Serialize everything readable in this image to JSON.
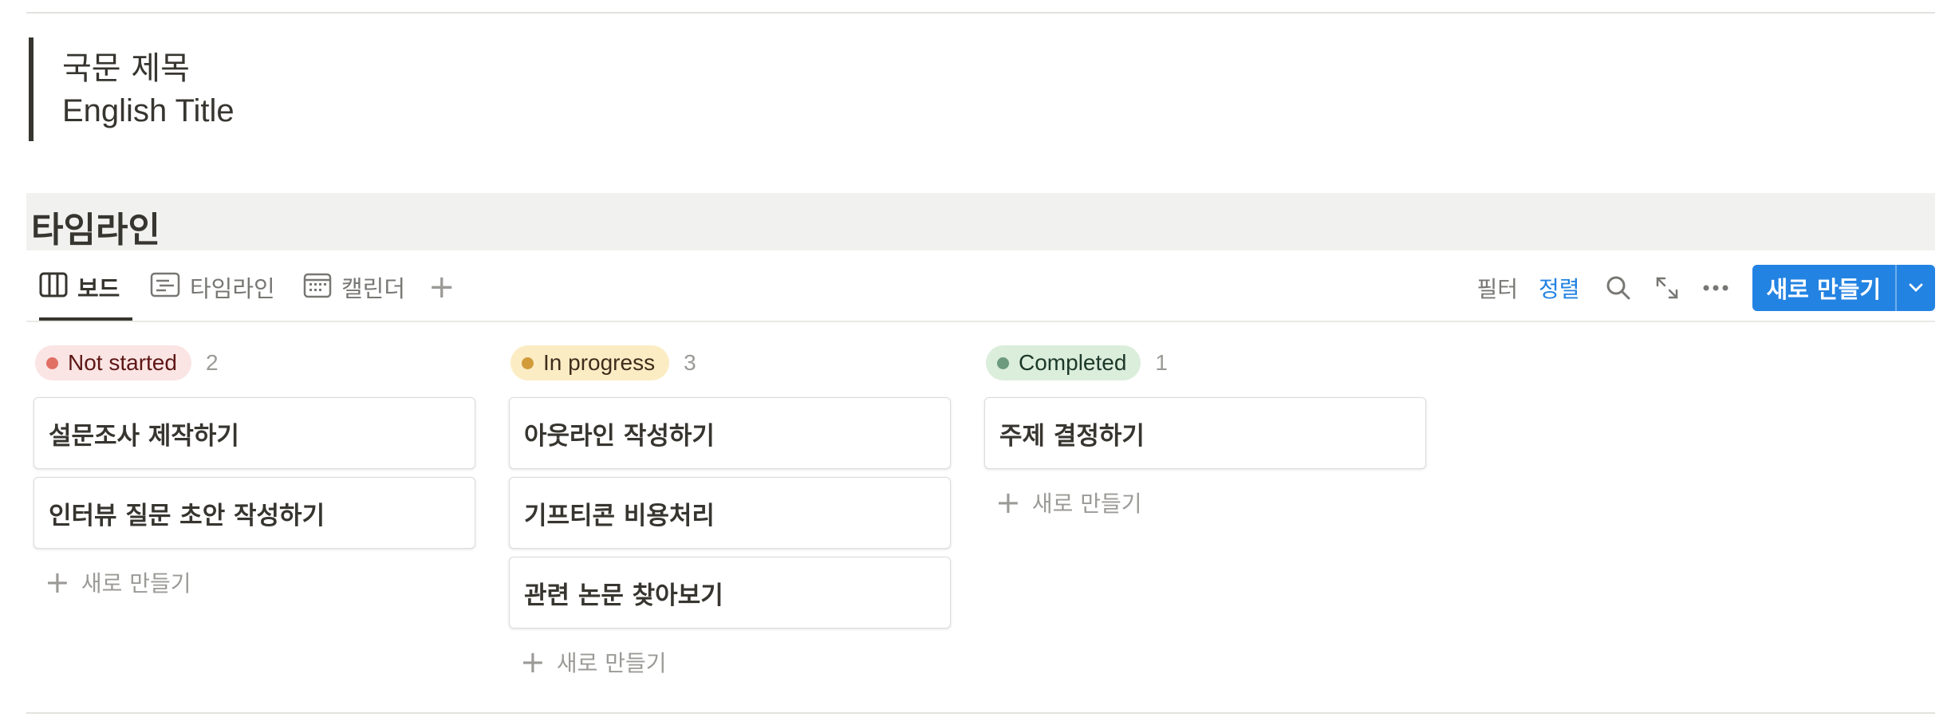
{
  "quote": {
    "line1": "국문 제목",
    "line2": "English Title"
  },
  "heading": "타임라인",
  "tabs": [
    {
      "label": "보드",
      "icon": "board-icon",
      "active": true
    },
    {
      "label": "타임라인",
      "icon": "timeline-icon",
      "active": false
    },
    {
      "label": "캘린더",
      "icon": "calendar-icon",
      "active": false
    }
  ],
  "toolbar": {
    "filter_label": "필터",
    "sort_label": "정렬",
    "new_label": "새로 만들기",
    "accent_color": "#2383e2"
  },
  "board": {
    "add_label": "새로 만들기",
    "columns": [
      {
        "status": "Not started",
        "count": "2",
        "pill_bg": "#fbe4e4",
        "dot_color": "#e16f64",
        "text_color": "#5d1715",
        "cards": [
          "설문조사 제작하기",
          "인터뷰 질문 초안 작성하기"
        ]
      },
      {
        "status": "In progress",
        "count": "3",
        "pill_bg": "#fbecc4",
        "dot_color": "#d19b3a",
        "text_color": "#402c1b",
        "cards": [
          "아웃라인 작성하기",
          "기프티콘 비용처리",
          "관련 논문 찾아보기"
        ]
      },
      {
        "status": "Completed",
        "count": "1",
        "pill_bg": "#dbeddb",
        "dot_color": "#6c9b7d",
        "text_color": "#1c3829",
        "cards": [
          "주제 결정하기"
        ]
      }
    ]
  }
}
